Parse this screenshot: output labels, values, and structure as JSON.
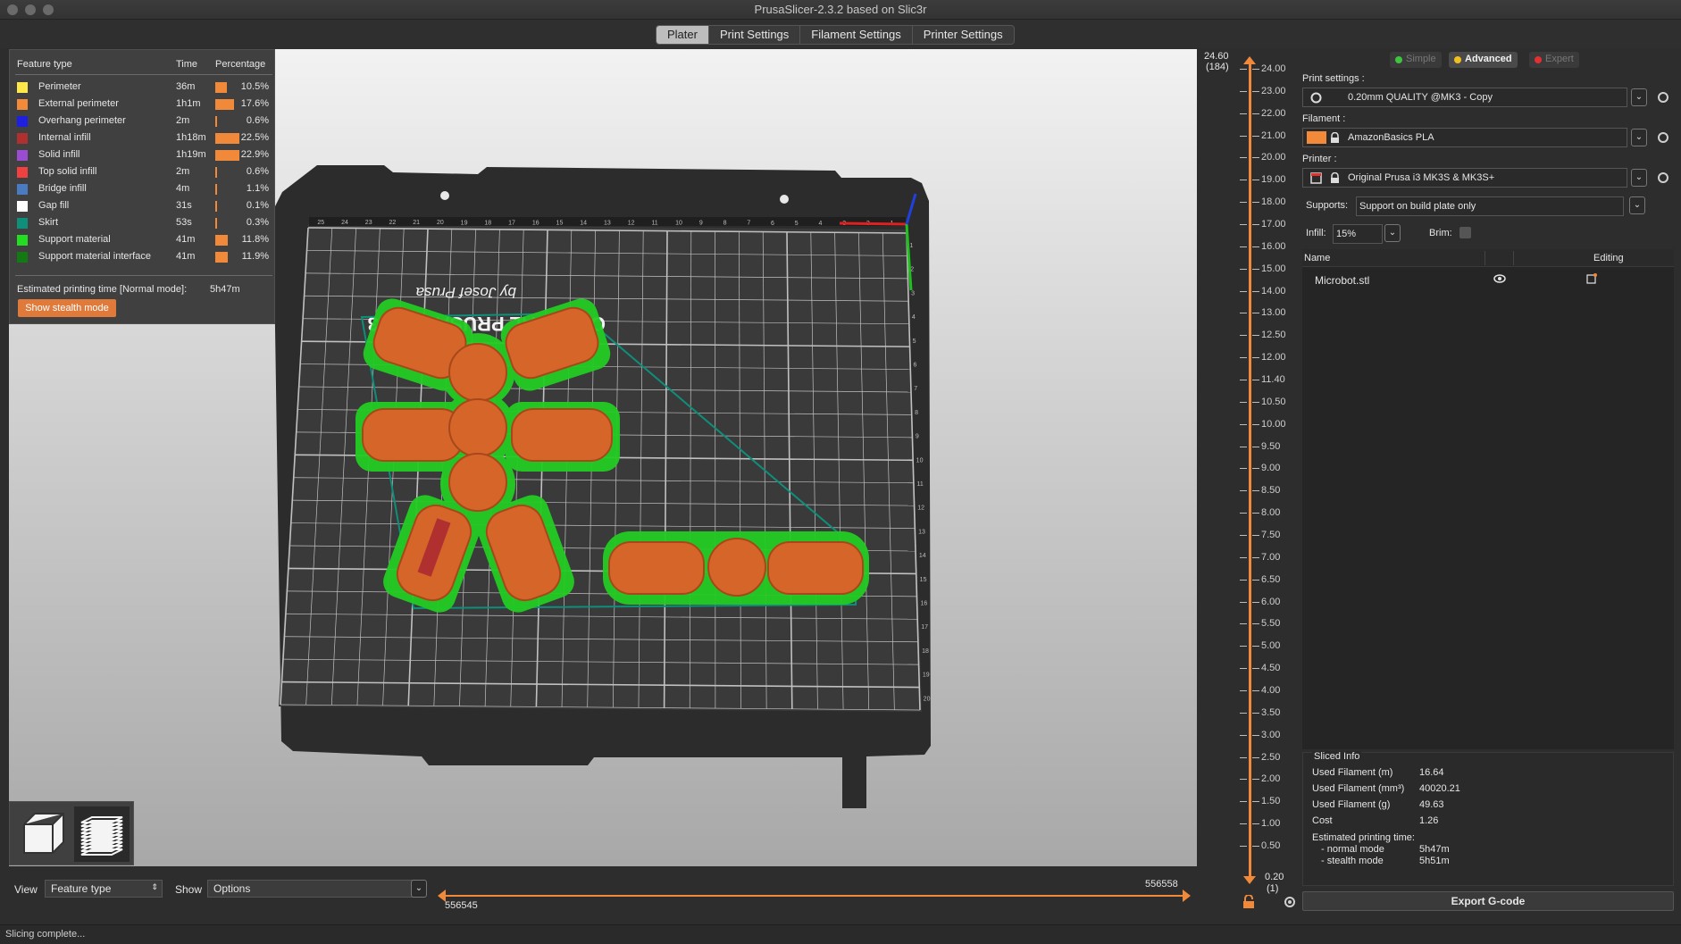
{
  "window": {
    "title": "PrusaSlicer-2.3.2 based on Slic3r"
  },
  "tabs": [
    {
      "label": "Plater",
      "active": true
    },
    {
      "label": "Print Settings"
    },
    {
      "label": "Filament Settings"
    },
    {
      "label": "Printer Settings"
    }
  ],
  "legend": {
    "headers": {
      "feature": "Feature type",
      "time": "Time",
      "percentage": "Percentage"
    },
    "rows": [
      {
        "name": "Perimeter",
        "time": "36m",
        "pct": "10.5%",
        "frac": 0.105,
        "color": "#ffe94a"
      },
      {
        "name": "External perimeter",
        "time": "1h1m",
        "pct": "17.6%",
        "frac": 0.176,
        "color": "#f28a3a"
      },
      {
        "name": "Overhang perimeter",
        "time": "2m",
        "pct": "0.6%",
        "frac": 0.006,
        "color": "#1f1fe0"
      },
      {
        "name": "Internal infill",
        "time": "1h18m",
        "pct": "22.5%",
        "frac": 0.225,
        "color": "#b03030"
      },
      {
        "name": "Solid infill",
        "time": "1h19m",
        "pct": "22.9%",
        "frac": 0.229,
        "color": "#9a4dd0"
      },
      {
        "name": "Top solid infill",
        "time": "2m",
        "pct": "0.6%",
        "frac": 0.006,
        "color": "#f04040"
      },
      {
        "name": "Bridge infill",
        "time": "4m",
        "pct": "1.1%",
        "frac": 0.011,
        "color": "#4a7bc0"
      },
      {
        "name": "Gap fill",
        "time": "31s",
        "pct": "0.1%",
        "frac": 0.001,
        "color": "#ffffff"
      },
      {
        "name": "Skirt",
        "time": "53s",
        "pct": "0.3%",
        "frac": 0.003,
        "color": "#0e8f7a"
      },
      {
        "name": "Support material",
        "time": "41m",
        "pct": "11.8%",
        "frac": 0.118,
        "color": "#22dd22"
      },
      {
        "name": "Support material interface",
        "time": "41m",
        "pct": "11.9%",
        "frac": 0.119,
        "color": "#137a13"
      }
    ],
    "estimated_label": "Estimated printing time [Normal mode]:",
    "estimated_value": "5h47m",
    "stealth_button": "Show stealth mode"
  },
  "bed": {
    "top_ruler": [
      "25",
      "24",
      "23",
      "22",
      "21",
      "20",
      "19",
      "18",
      "17",
      "16",
      "15",
      "14",
      "13",
      "12",
      "11",
      "10",
      "9",
      "8",
      "7",
      "6",
      "5",
      "4",
      "3",
      "2",
      "1"
    ],
    "side_ruler": [
      "1",
      "2",
      "3",
      "4",
      "5",
      "6",
      "7",
      "8",
      "9",
      "10",
      "11",
      "12",
      "13",
      "14",
      "15",
      "16",
      "17",
      "18",
      "19",
      "20"
    ],
    "logo_line1": "ORIGINAL PRUSA i3 MK3",
    "logo_line2": "by Josef Prusa"
  },
  "view_toggle": {
    "items": [
      "3d-view",
      "layers-view"
    ]
  },
  "bottom": {
    "view_label": "View",
    "view_value": "Feature type",
    "show_label": "Show",
    "show_value": "Options",
    "slider_left_value": "556545",
    "slider_right_value": "556558"
  },
  "vslider": {
    "top_value": "24.60",
    "top_layer": "(184)",
    "bottom_value": "0.20",
    "bottom_layer": "(1)",
    "ticks": [
      "24.00",
      "23.00",
      "22.00",
      "21.00",
      "20.00",
      "19.00",
      "18.00",
      "17.00",
      "16.00",
      "15.00",
      "14.00",
      "13.00",
      "12.50",
      "12.00",
      "11.40",
      "10.50",
      "10.00",
      "9.50",
      "9.00",
      "8.50",
      "8.00",
      "7.50",
      "7.00",
      "6.50",
      "6.00",
      "5.50",
      "5.00",
      "4.50",
      "4.00",
      "3.50",
      "3.00",
      "2.50",
      "2.00",
      "1.50",
      "1.00",
      "0.50"
    ]
  },
  "right_panel": {
    "modes": [
      {
        "label": "Simple",
        "color": "#3ec43e",
        "active": false
      },
      {
        "label": "Advanced",
        "color": "#f0c020",
        "active": true
      },
      {
        "label": "Expert",
        "color": "#e03030",
        "active": false
      }
    ],
    "print_settings_label": "Print settings :",
    "print_settings_value": "0.20mm QUALITY @MK3 - Copy",
    "filament_label": "Filament :",
    "filament_value": "AmazonBasics PLA",
    "filament_color": "#f28a3a",
    "printer_label": "Printer :",
    "printer_value": "Original Prusa i3 MK3S & MK3S+",
    "supports_label": "Supports:",
    "supports_value": "Support on build plate only",
    "infill_label": "Infill:",
    "infill_value": "15%",
    "brim_label": "Brim:",
    "list_headers": {
      "name": "Name",
      "editing": "Editing"
    },
    "objects": [
      {
        "name": "Microbot.stl"
      }
    ],
    "sliced_info": {
      "title": "Sliced Info",
      "rows": [
        {
          "label": "Used Filament (m)",
          "value": "16.64"
        },
        {
          "label": "Used Filament (mm³)",
          "value": "40020.21"
        },
        {
          "label": "Used Filament (g)",
          "value": "49.63"
        },
        {
          "label": "Cost",
          "value": "1.26"
        }
      ],
      "est_label": "Estimated printing time:",
      "normal_label": "- normal mode",
      "normal_value": "5h47m",
      "stealth_label": "- stealth mode",
      "stealth_value": "5h51m"
    },
    "export_button": "Export G-code"
  },
  "status": {
    "text": "Slicing complete..."
  }
}
